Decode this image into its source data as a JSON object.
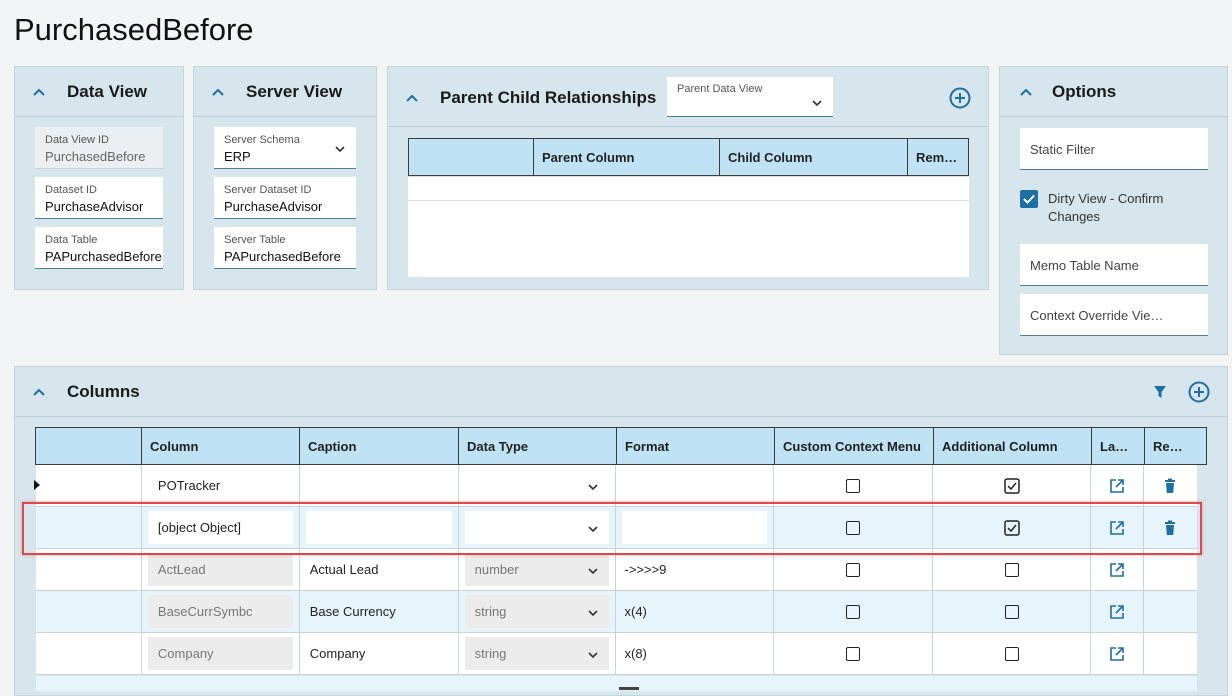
{
  "page": {
    "title": "PurchasedBefore"
  },
  "data_view": {
    "title": "Data View",
    "fields": [
      {
        "label": "Data View ID",
        "value": "PurchasedBefore"
      },
      {
        "label": "Dataset ID",
        "value": "PurchaseAdvisor"
      },
      {
        "label": "Data Table",
        "value": "PAPurchasedBefore"
      }
    ]
  },
  "server_view": {
    "title": "Server View",
    "fields": [
      {
        "label": "Server Schema",
        "value": "ERP"
      },
      {
        "label": "Server Dataset ID",
        "value": "PurchaseAdvisor"
      },
      {
        "label": "Server Table",
        "value": "PAPurchasedBefore"
      }
    ]
  },
  "parent_child": {
    "title": "Parent Child Relationships",
    "parent_data_view_label": "Parent Data View",
    "parent_data_view_value": "",
    "columns": [
      "",
      "Parent Column",
      "Child Column",
      "Rem…"
    ]
  },
  "options": {
    "title": "Options",
    "static_filter_placeholder": "Static Filter",
    "dirty_view_label": "Dirty View - Confirm Changes",
    "dirty_view_checked": true,
    "memo_table_placeholder": "Memo Table Name",
    "context_override_placeholder": "Context Override Vie…"
  },
  "columns_panel": {
    "title": "Columns",
    "headers": [
      "",
      "Column",
      "Caption",
      "Data Type",
      "Format",
      "Custom Context Menu",
      "Additional Column",
      "La…",
      "Re…"
    ],
    "rows": [
      {
        "column": "POTracker",
        "caption": "",
        "data_type": "",
        "format": "",
        "custom_context_menu": false,
        "additional_column": true,
        "editable": true,
        "removable": true,
        "current": true
      },
      {
        "column": "[object Object]",
        "caption": "",
        "data_type": "",
        "format": "",
        "custom_context_menu": false,
        "additional_column": true,
        "editable": true,
        "removable": true,
        "highlighted": true
      },
      {
        "column": "ActLead",
        "caption": "Actual Lead",
        "data_type": "number",
        "format": "->>>>9",
        "custom_context_menu": false,
        "additional_column": false,
        "editable": false,
        "removable": false
      },
      {
        "column": "BaseCurrSymbc",
        "caption": "Base Currency",
        "data_type": "string",
        "format": "x(4)",
        "custom_context_menu": false,
        "additional_column": false,
        "editable": false,
        "removable": false
      },
      {
        "column": "Company",
        "caption": "Company",
        "data_type": "string",
        "format": "x(8)",
        "custom_context_menu": false,
        "additional_column": false,
        "editable": false,
        "removable": false
      }
    ]
  },
  "colors": {
    "panel_bg": "#d6e6ec",
    "header_bg": "#bfe3f5",
    "accent": "#1e6fa3",
    "highlight_border": "#e0474c",
    "alt_row": "#e8f4fb"
  }
}
